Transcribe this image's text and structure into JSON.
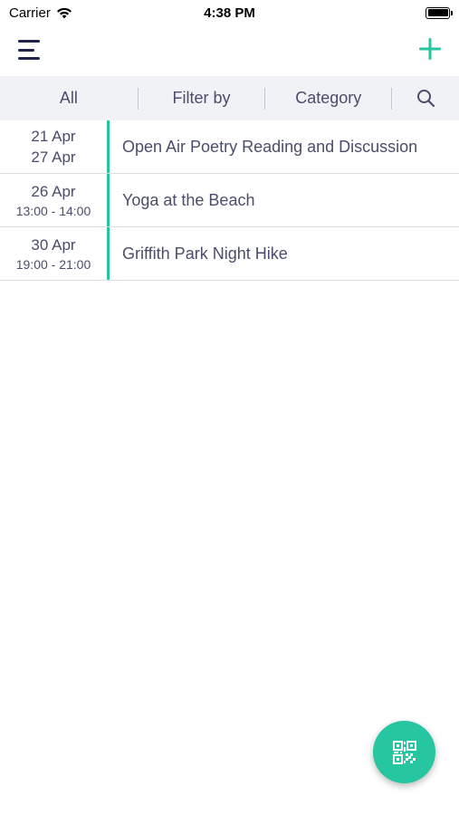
{
  "status_bar": {
    "carrier": "Carrier",
    "time": "4:38 PM"
  },
  "nav": {
    "menu_icon": "hamburger-menu-icon",
    "add_icon": "plus-icon",
    "accent_color": "#26c6a0"
  },
  "filter_bar": {
    "all": "All",
    "filter_by": "Filter by",
    "category": "Category",
    "search_icon": "search-icon"
  },
  "events": [
    {
      "date": "21 Apr",
      "date2": "27 Apr",
      "title": "Open Air Poetry Reading and Discussion"
    },
    {
      "date": "26 Apr",
      "time": "13:00 - 14:00",
      "title": "Yoga at the Beach"
    },
    {
      "date": "30 Apr",
      "time": "19:00 - 21:00",
      "title": "Griffith Park Night Hike"
    }
  ],
  "fab": {
    "icon": "qr-code-icon",
    "color": "#26c6a0"
  }
}
